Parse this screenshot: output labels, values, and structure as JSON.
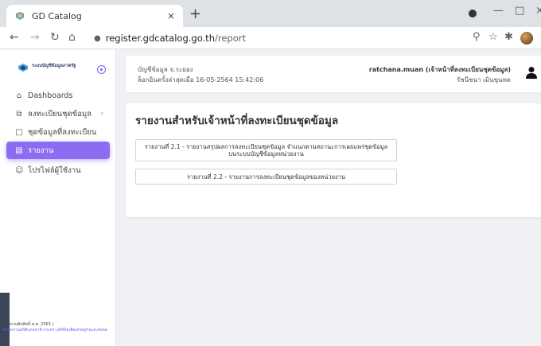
{
  "browser": {
    "tab_title": "GD Catalog",
    "tab_close": "×",
    "new_tab": "+",
    "url_host": "register.gdcatalog.go.th",
    "url_path": "/report"
  },
  "sidebar": {
    "brand": "ระบบบัญชีข้อมูลภาครัฐ",
    "items": [
      {
        "label": "Dashboards",
        "icon": "home-icon"
      },
      {
        "label": "ลงทะเบียนชุดข้อมูล",
        "icon": "copy-icon"
      },
      {
        "label": "ชุดข้อมูลที่ลงทะเบียน",
        "icon": "folder-icon"
      },
      {
        "label": "รายงาน",
        "icon": "report-icon"
      },
      {
        "label": "โปรไฟล์ผู้ใช้งาน",
        "icon": "user-icon"
      }
    ],
    "footer_copy": "© สงวนลิขสิทธิ์ พ.ศ. 2563 |",
    "footer_link": "สำนักงานสถิติแห่งชาติ กระทรวงดิจิทัลเพื่อเศรษฐกิจและสังคม"
  },
  "header": {
    "account_label": "บัญชีข้อมูล จ.ระยอง",
    "last_login": "ล็อกอินครั้งล่าสุดเมื่อ 16-05-2564 15:42:06",
    "user_role": "ratchana.muan (เจ้าหน้าที่ลงทะเบียนชุดข้อมูล)",
    "user_name": "รัชนีชนา เมินขุนทด"
  },
  "report": {
    "title": "รายงานสำหรับเจ้าหน้าที่ลงทะเบียนชุดข้อมูล",
    "buttons": [
      "รายงานที่ 2.1 - รายงานสรุปผลการลงทะเบียนชุดข้อมูล จำแนกตามสถานะการเผยแพร่ชุดข้อมูลบนระบบบัญชีข้อมูลหน่วยงาน",
      "รายงานที่ 2.2 - รายงานการลงทะเบียนชุดข้อมูลของหน่วยงาน"
    ]
  },
  "colors": {
    "accent": "#8c6cf3",
    "background": "#f0f1f5"
  }
}
